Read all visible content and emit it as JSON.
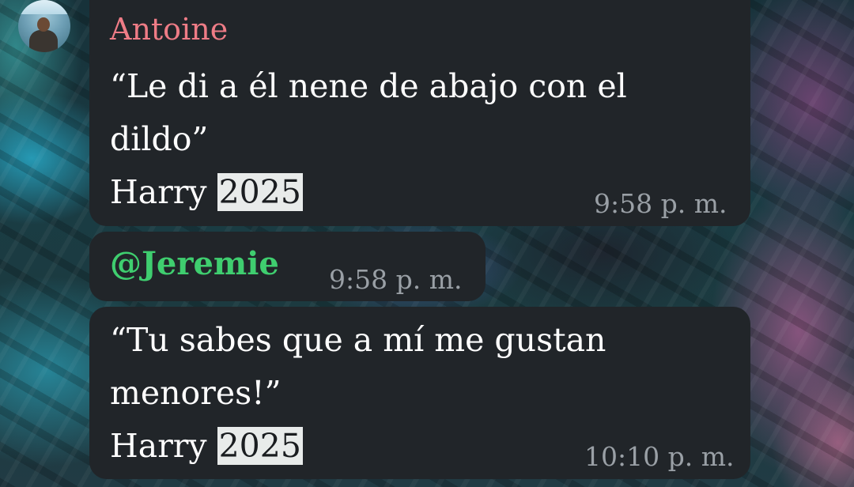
{
  "messages": [
    {
      "sender": "Antoine",
      "lines": [
        "“Le di a él nene de abajo con el",
        "dildo”"
      ],
      "signature_prefix": "Harry ",
      "signature_highlight": "2025",
      "time": "9:58 p. m."
    },
    {
      "mention": "@Jeremie",
      "time": "9:58 p. m."
    },
    {
      "lines": [
        "“Tu sabes que a mí me gustan",
        "menores!”"
      ],
      "signature_prefix": "Harry ",
      "signature_highlight": "2025",
      "time": "10:10 p. m."
    }
  ],
  "colors": {
    "bubble": "#212529",
    "sender_name": "#ee7c86",
    "mention": "#3fce6f",
    "timestamp": "#9aa0a6",
    "highlight_bg": "#e8ebea"
  },
  "icons": {
    "avatar": "user-avatar-photo"
  }
}
